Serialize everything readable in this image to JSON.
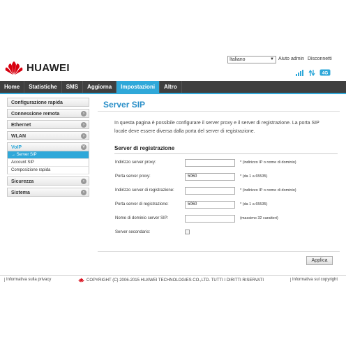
{
  "header": {
    "brand": "HUAWEI",
    "language": "Italiano",
    "help": "Aiuto",
    "user": "admin",
    "logout": "Disconnetti"
  },
  "nav": {
    "items": [
      "Home",
      "Statistiche",
      "SMS",
      "Aggiorna",
      "Impostazioni",
      "Altro"
    ],
    "active": "Impostazioni"
  },
  "sidebar": {
    "items": [
      {
        "label": "Configurazione rapida"
      },
      {
        "label": "Connessione remota"
      },
      {
        "label": "Ethernet"
      },
      {
        "label": "WLAN"
      },
      {
        "label": "VoIP"
      },
      {
        "label": "Sicurezza"
      },
      {
        "label": "Sistema"
      }
    ],
    "voip_sub": [
      "→ Server SIP",
      "Account SIP",
      "Composizione rapida"
    ]
  },
  "main": {
    "title": "Server SIP",
    "description": "In questa pagina è possibile configurare il server proxy e il server di registrazione. La porta SIP locale deve essere diversa dalla porta del server di registrazione.",
    "section_title": "Server di registrazione",
    "fields": [
      {
        "label": "Indirizzo server proxy:",
        "value": "",
        "hint": "* (indirizzo IP o nome di dominio)"
      },
      {
        "label": "Porta server proxy:",
        "value": "5060",
        "hint": "* (da 1 a 65535)"
      },
      {
        "label": "Indirizzo server di registrazione:",
        "value": "",
        "hint": "* (indirizzo IP o nome di dominio)"
      },
      {
        "label": "Porta server di registrazione:",
        "value": "5060",
        "hint": "* (da 1 a 65535)"
      },
      {
        "label": "Nome di dominio server SIP:",
        "value": "",
        "hint": "(massimo 32 caratteri)"
      }
    ],
    "secondary_label": "Server secondario:",
    "apply": "Applica"
  },
  "footer": {
    "privacy": "Informativa sulla privacy",
    "copyright": "COPYRIGHT (C) 2006-2015 HUAWEI TECHNOLOGIES CO.,LTD. TUTTI I DIRITTI RISERVATI",
    "copyright_link": "Informativa sul copyright"
  },
  "colors": {
    "accent": "#2fa8d9",
    "navbar": "#3f3f3f",
    "title": "#2a8fc8",
    "brand_red": "#d7000f"
  },
  "icons": [
    "huawei-logo-icon",
    "signal-icon",
    "transfer-icon",
    "4g-icon",
    "chevron-down-icon",
    "chevron-right-icon"
  ]
}
